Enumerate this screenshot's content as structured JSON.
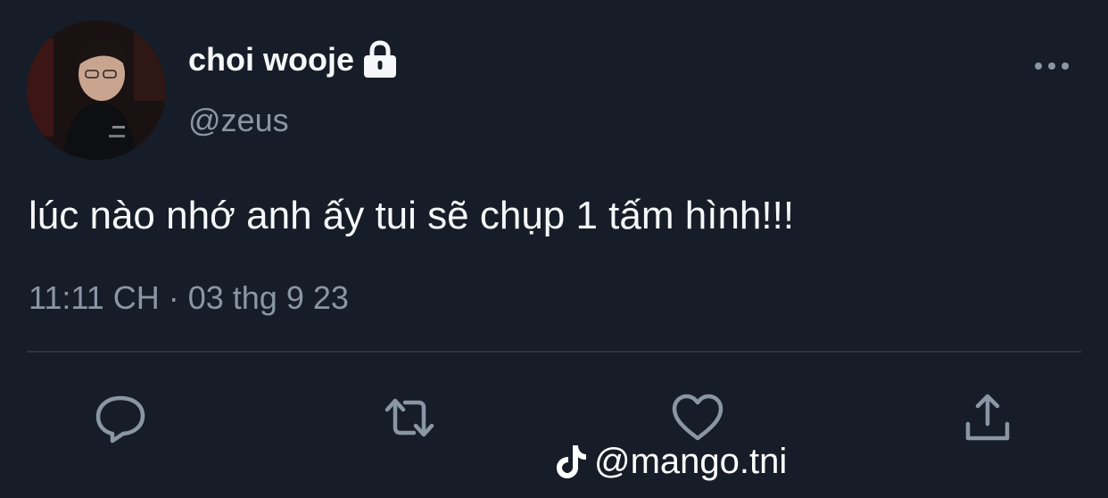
{
  "user": {
    "display_name": "choi wooje",
    "handle": "@zeus",
    "avatar_icon": "profile-photo",
    "protected_icon": "lock-icon"
  },
  "tweet": {
    "text": "lúc nào nhớ anh ấy tui sẽ chụp 1 tấm hình!!!",
    "timestamp": "11:11 CH · 03 thg 9 23"
  },
  "actions": [
    {
      "name": "reply",
      "icon": "comment-bubble-icon"
    },
    {
      "name": "retweet",
      "icon": "retweet-icon"
    },
    {
      "name": "like",
      "icon": "heart-icon"
    },
    {
      "name": "share",
      "icon": "share-icon"
    }
  ],
  "menu": {
    "icon": "more-options-icon"
  },
  "watermark": {
    "icon": "tiktok-icon",
    "text": "@mango.tni"
  },
  "colors": {
    "background": "#161d28",
    "primary_text": "#f5f7f9",
    "secondary_text": "#8a96a3",
    "divider": "#2b3440",
    "icon": "#8a96a3"
  }
}
